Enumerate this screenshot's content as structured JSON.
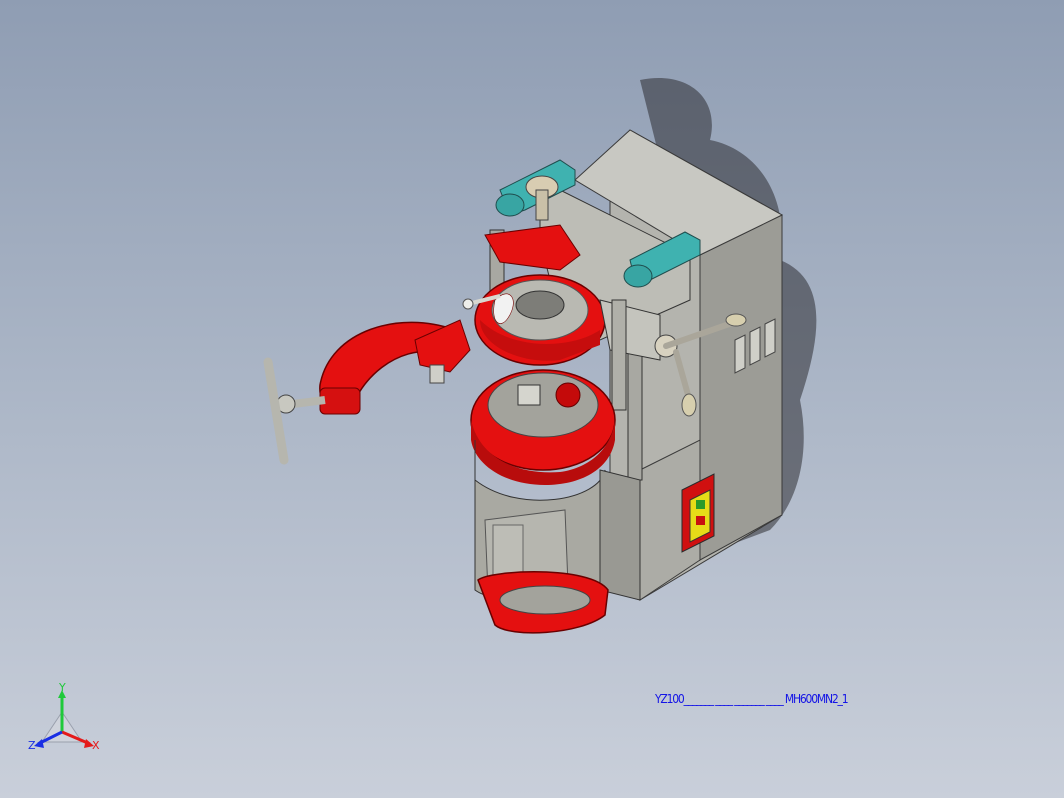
{
  "view": {
    "kind": "3d-cad-model",
    "subject": "pipe-threading-machine",
    "colors": {
      "background_top": "#8f9db3",
      "background_bottom": "#c9cfda",
      "body_gray": "#a3a39c",
      "part_red": "#e41010",
      "handle_teal": "#3fb2b0",
      "caption_blue": "#1414e6"
    }
  },
  "triad": {
    "y_label": "Y",
    "x_label": "X",
    "z_label": "Z",
    "y_color": "#1fc93a",
    "x_color": "#e41a1a",
    "z_color": "#1a2fe4"
  },
  "caption": {
    "text": "YZ100_______ ____  _______ ____  MH600MN2_1"
  }
}
